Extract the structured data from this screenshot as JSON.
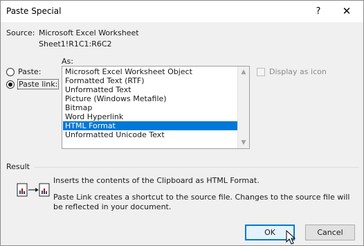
{
  "window": {
    "title": "Paste Special",
    "help_glyph": "?",
    "close_glyph": "✕"
  },
  "source": {
    "label": "Source:",
    "value": "Microsoft Excel Worksheet",
    "range": "Sheet1!R1C1:R6C2"
  },
  "as_label": "As:",
  "paste_options": [
    {
      "label": "Paste:",
      "checked": false
    },
    {
      "label": "Paste link:",
      "checked": true
    }
  ],
  "formats": [
    {
      "label": "Microsoft Excel Worksheet Object",
      "selected": false
    },
    {
      "label": "Formatted Text (RTF)",
      "selected": false
    },
    {
      "label": "Unformatted Text",
      "selected": false
    },
    {
      "label": "Picture (Windows Metafile)",
      "selected": false
    },
    {
      "label": "Bitmap",
      "selected": false
    },
    {
      "label": "Word Hyperlink",
      "selected": false
    },
    {
      "label": "HTML Format",
      "selected": true
    },
    {
      "label": "Unformatted Unicode Text",
      "selected": false
    }
  ],
  "display_as_icon": {
    "label": "Display as icon",
    "checked": false,
    "enabled": false
  },
  "result": {
    "label": "Result",
    "line1": "Inserts the contents of the Clipboard as HTML Format.",
    "line2": "Paste Link creates a shortcut to the source file. Changes to the source file will be reflected in your document."
  },
  "buttons": {
    "ok": "OK",
    "cancel": "Cancel"
  },
  "colors": {
    "selection": "#0078d7",
    "dialog_bg": "#f0f0f0"
  }
}
